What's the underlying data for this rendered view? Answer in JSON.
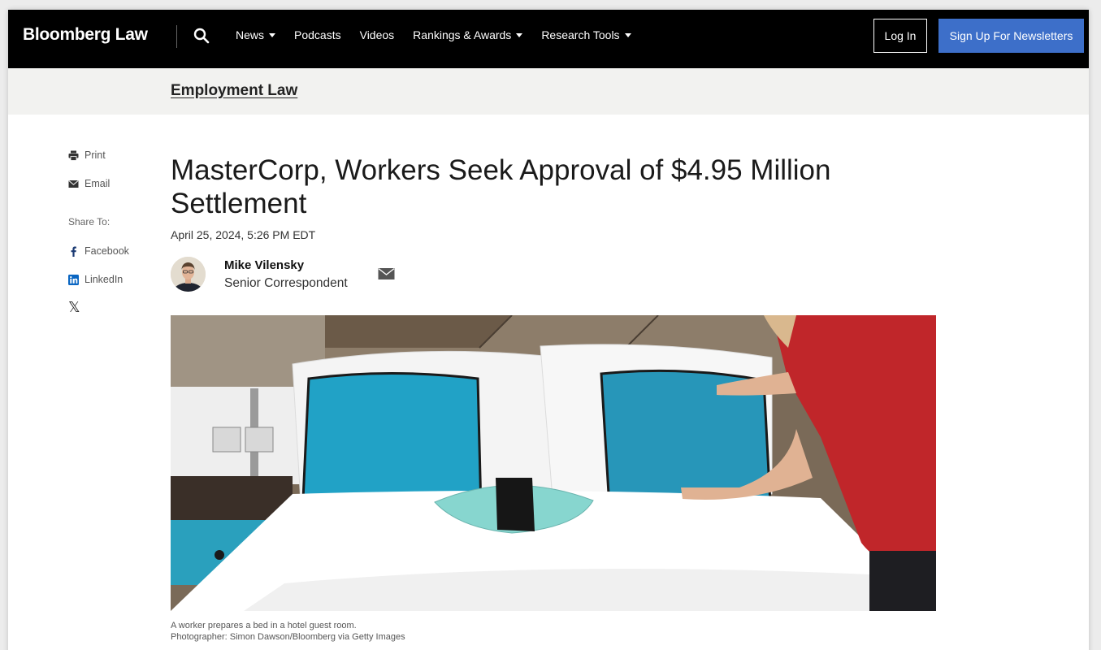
{
  "header": {
    "logo": "Bloomberg Law",
    "nav": [
      {
        "label": "News",
        "dropdown": true
      },
      {
        "label": "Podcasts",
        "dropdown": false
      },
      {
        "label": "Videos",
        "dropdown": false
      },
      {
        "label": "Rankings & Awards",
        "dropdown": true
      },
      {
        "label": "Research Tools",
        "dropdown": true
      }
    ],
    "login_label": "Log In",
    "signup_label": "Sign Up For Newsletters"
  },
  "section": {
    "label": "Employment Law"
  },
  "share": {
    "print_label": "Print",
    "email_label": "Email",
    "share_to_label": "Share To:",
    "facebook_label": "Facebook",
    "linkedin_label": "LinkedIn",
    "x_label": "𝕏"
  },
  "article": {
    "headline": "MasterCorp, Workers Seek Approval of $4.95 Million Settlement",
    "date": "April 25, 2024, 5:26 PM EDT",
    "author": {
      "name": "Mike Vilensky",
      "title": "Senior Correspondent"
    },
    "caption_line1": "A worker prepares a bed in a hotel guest room.",
    "caption_line2": "Photographer: Simon Dawson/Bloomberg via Getty Images"
  },
  "colors": {
    "nav_bg": "#000000",
    "signup_bg": "#3d6fc9",
    "section_bar_bg": "#f2f2f0"
  }
}
